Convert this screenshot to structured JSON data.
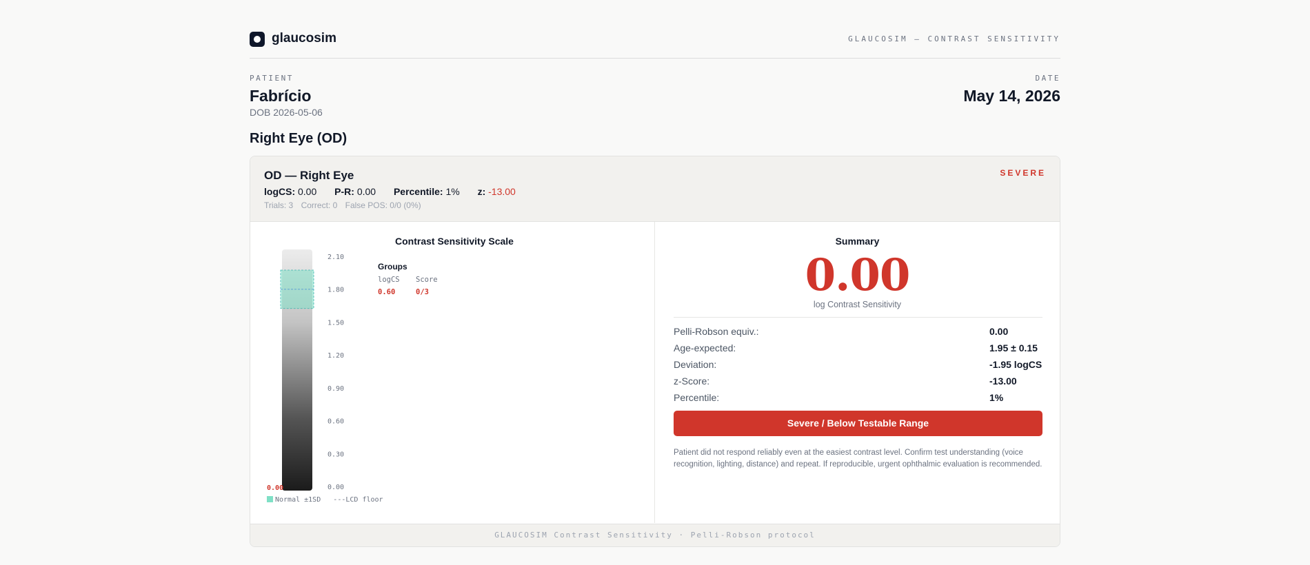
{
  "header": {
    "brand": "glaucosim",
    "right_title": "GLAUCOSIM — CONTRAST SENSITIVITY"
  },
  "patient": {
    "label": "PATIENT",
    "name": "Fabrício",
    "dob": "DOB 2026-05-06"
  },
  "date": {
    "label": "DATE",
    "value": "May 14, 2026"
  },
  "eye_title": "Right Eye (OD)",
  "card": {
    "title": "OD — Right Eye",
    "severity": "SEVERE",
    "metrics": {
      "logcs_label": "logCS:",
      "logcs_value": "0.00",
      "pr_label": "P-R:",
      "pr_value": "0.00",
      "percentile_label": "Percentile:",
      "percentile_value": "1%",
      "z_label": "z:",
      "z_value": "-13.00"
    },
    "trials": {
      "trials": "Trials: 3",
      "correct": "Correct: 0",
      "false_pos": "False POS: 0/0 (0%)"
    }
  },
  "scale": {
    "title": "Contrast Sensitivity Scale",
    "ticks": [
      "2.10",
      "1.80",
      "1.50",
      "1.20",
      "0.90",
      "0.60",
      "0.30",
      "0.00"
    ],
    "marker_value": "0.00",
    "legend_normal": "Normal ±1SD",
    "legend_floor": "LCD floor",
    "groups_title": "Groups",
    "groups_headers": [
      "logCS",
      "Score"
    ],
    "groups_rows": [
      {
        "logcs": "0.60",
        "score": "0/3"
      }
    ]
  },
  "chart_data": {
    "type": "bar",
    "title": "Contrast Sensitivity Scale",
    "ylim": [
      0,
      2.1
    ],
    "ticks": [
      2.1,
      1.8,
      1.5,
      1.2,
      0.9,
      0.6,
      0.3,
      0.0
    ],
    "value": 0.0,
    "normal_band": [
      1.8,
      2.1
    ],
    "normal_mean": 1.95,
    "legend": [
      "Normal ±1SD",
      "LCD floor"
    ]
  },
  "summary": {
    "title": "Summary",
    "value": "0.00",
    "caption": "log Contrast Sensitivity",
    "rows": [
      {
        "label": "Pelli-Robson equiv.:",
        "value": "0.00"
      },
      {
        "label": "Age-expected:",
        "value": "1.95 ± 0.15"
      },
      {
        "label": "Deviation:",
        "value": "-1.95 logCS"
      },
      {
        "label": "z-Score:",
        "value": "-13.00"
      },
      {
        "label": "Percentile:",
        "value": "1%"
      }
    ],
    "severity_button": "Severe / Below Testable Range",
    "note": "Patient did not respond reliably even at the easiest contrast level. Confirm test understanding (voice recognition, lighting, distance) and repeat. If reproducible, urgent ophthalmic evaluation is recommended."
  },
  "footer": {
    "text": "GLAUCOSIM Contrast Sensitivity · Pelli-Robson protocol"
  },
  "colors": {
    "accent_red": "#d0362b",
    "normal_band": "#7fe0c6",
    "dark": "#0f172a"
  }
}
